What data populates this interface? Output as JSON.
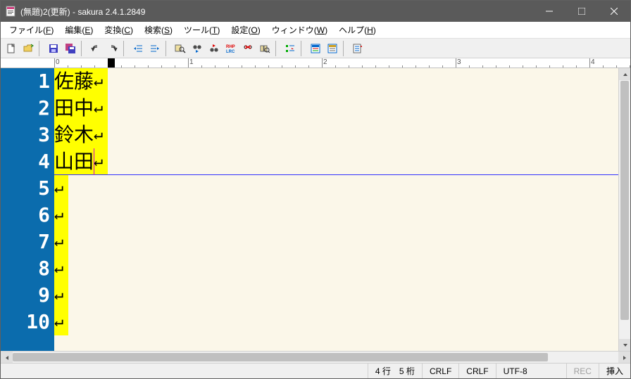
{
  "title": "(無題)2(更新) - sakura 2.4.1.2849",
  "menu": {
    "file": "ファイル(F)",
    "edit": "編集(E)",
    "convert": "変換(C)",
    "search": "検索(S)",
    "tools": "ツール(T)",
    "settings": "設定(O)",
    "window": "ウィンドウ(W)",
    "help": "ヘルプ(H)"
  },
  "ruler_labels": [
    "0",
    "1",
    "2",
    "3",
    "4"
  ],
  "lines": [
    {
      "num": "1",
      "text": "佐藤",
      "hl": true
    },
    {
      "num": "2",
      "text": "田中",
      "hl": true
    },
    {
      "num": "3",
      "text": "鈴木",
      "hl": true
    },
    {
      "num": "4",
      "text": "山田",
      "hl": true
    },
    {
      "num": "5",
      "text": "",
      "hl": false
    },
    {
      "num": "6",
      "text": "",
      "hl": false
    },
    {
      "num": "7",
      "text": "",
      "hl": false
    },
    {
      "num": "8",
      "text": "",
      "hl": false
    },
    {
      "num": "9",
      "text": "",
      "hl": false
    },
    {
      "num": "10",
      "text": "",
      "hl": false
    }
  ],
  "cursor_line_index": 3,
  "status": {
    "pos": "4 行　5 桁",
    "eol1": "CRLF",
    "eol2": "CRLF",
    "encoding": "UTF-8",
    "rec": "REC",
    "insert": "挿入"
  }
}
